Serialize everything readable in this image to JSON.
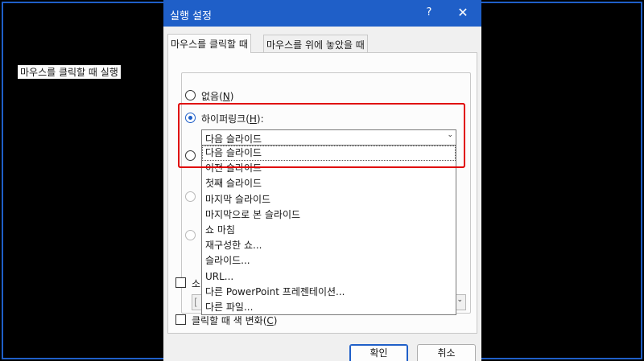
{
  "window": {
    "title": "실행 설정",
    "help_glyph": "?",
    "close_glyph": "✕"
  },
  "tabs": [
    {
      "label": "마우스를 클릭할 때",
      "active": true
    },
    {
      "label": "마우스를 위에 놓았을 때",
      "active": false
    }
  ],
  "group_label": "마우스를 클릭할 때 실행",
  "options": {
    "none": {
      "text": "없음(",
      "key": "N",
      "tail": ")"
    },
    "hyperlink": {
      "text": "하이퍼링크(",
      "key": "H",
      "tail": "):"
    }
  },
  "hyperlink_select": {
    "value": "다음 슬라이드",
    "arrow": "⌄",
    "items": [
      "다음 슬라이드",
      "이전 슬라이드",
      "첫째 슬라이드",
      "마지막 슬라이드",
      "마지막으로 본 슬라이드",
      "쇼 마침",
      "재구성한 쇼...",
      "슬라이드...",
      "URL...",
      "다른 PowerPoint 프레젠테이션...",
      "다른 파일..."
    ],
    "selected_index": 0
  },
  "sound_checkbox": {
    "text": "소"
  },
  "sound_select": {
    "text": "[",
    "arrow": "⌄"
  },
  "highlight_checkbox": {
    "text": "클릭할 때 색 변화(",
    "key": "C",
    "tail": ")"
  },
  "buttons": {
    "ok": "확인",
    "cancel": "취소"
  },
  "colors": {
    "titlebar": "#1f5fc8",
    "annotation": "#e00000"
  }
}
